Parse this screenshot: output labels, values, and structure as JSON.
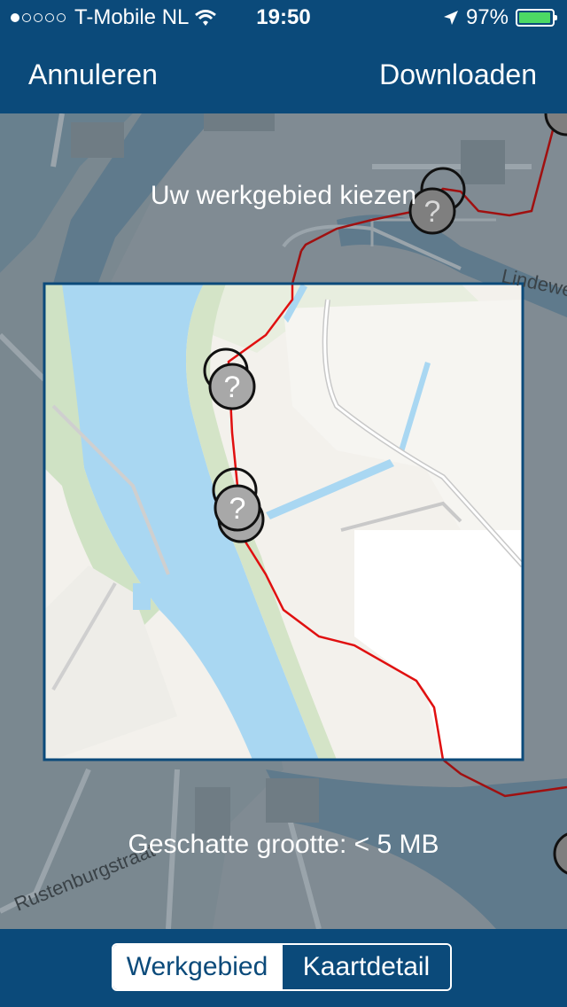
{
  "status_bar": {
    "carrier": "T-Mobile NL",
    "time": "19:50",
    "battery": "97%",
    "signal_dots_filled": 1,
    "signal_dots_total": 5,
    "battery_color": "#4cd964"
  },
  "nav": {
    "cancel_label": "Annuleren",
    "download_label": "Downloaden",
    "background": "#0b4a7a"
  },
  "map": {
    "title": "Uw werkgebied kiezen",
    "estimated_size": "Geschatte grootte: < 5 MB",
    "street_labels": [
      "Rustenburgstraat",
      "Lindewe"
    ],
    "marker_symbol": "?",
    "route_color": "#e01010",
    "selection_border_color": "#0b4a7a"
  },
  "toolbar": {
    "segments": [
      "Werkgebied",
      "Kaartdetail"
    ],
    "selected_index": 0
  },
  "icons": {
    "wifi": "wifi-icon",
    "location": "location-arrow-icon",
    "battery": "battery-icon",
    "marker": "question-marker-icon"
  }
}
